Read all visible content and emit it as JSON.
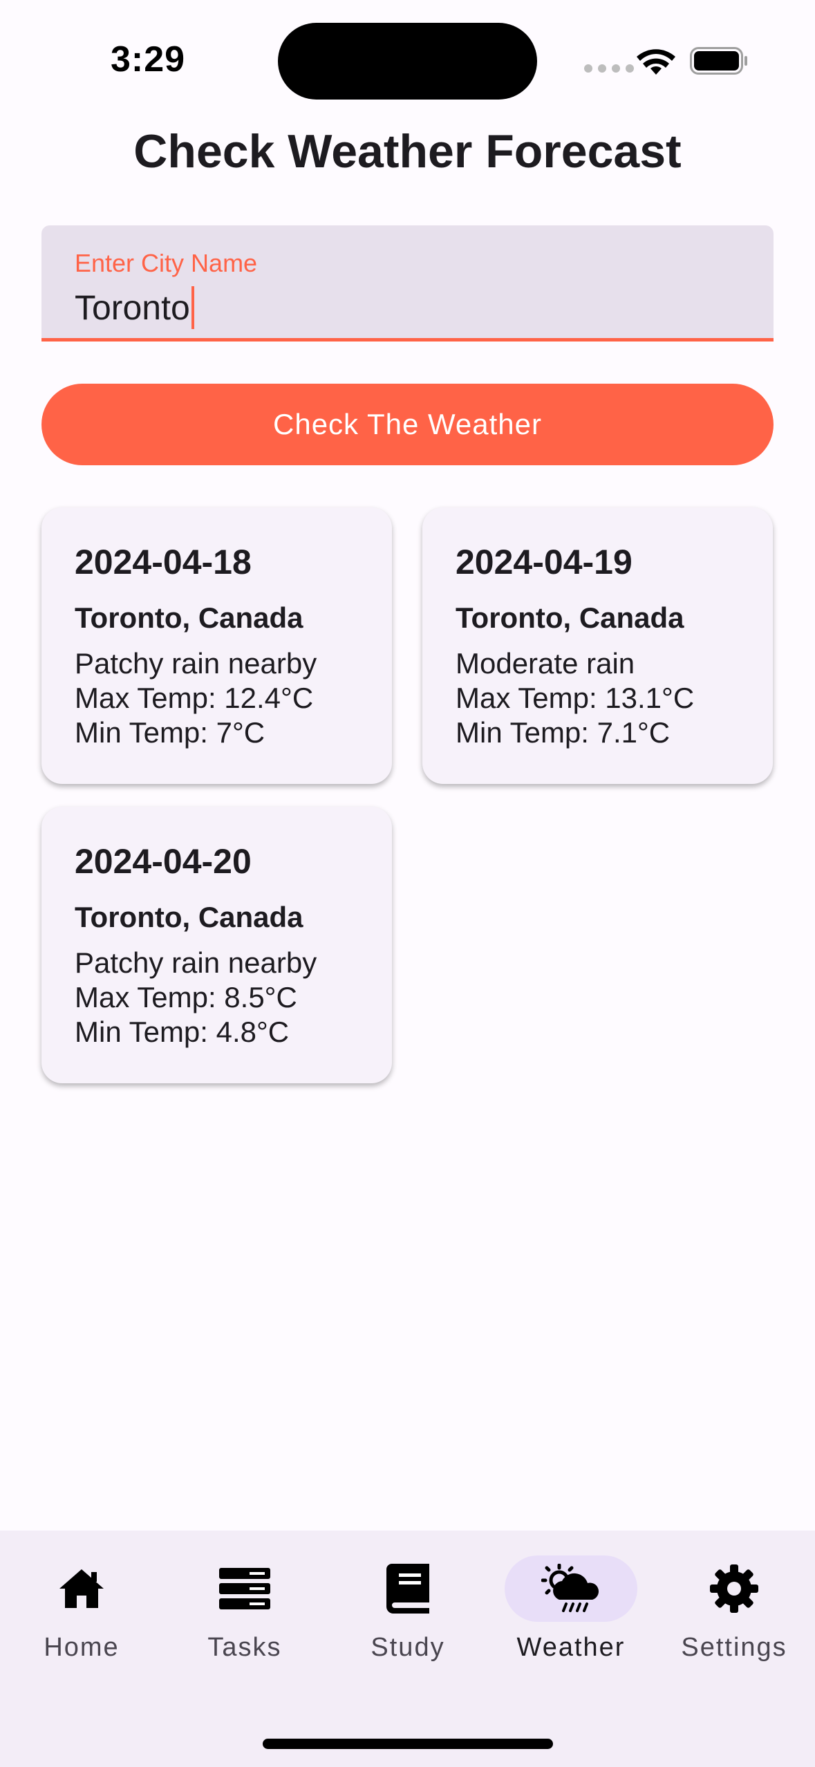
{
  "status_bar": {
    "time": "3:29"
  },
  "header": {
    "title": "Check Weather Forecast"
  },
  "search": {
    "label": "Enter City Name",
    "value": "Toronto"
  },
  "action": {
    "button_label": "Check The Weather"
  },
  "forecasts": [
    {
      "date": "2024-04-18",
      "location": "Toronto, Canada",
      "condition": "Patchy rain nearby",
      "max": "Max Temp: 12.4°C",
      "min": "Min Temp: 7°C"
    },
    {
      "date": "2024-04-19",
      "location": "Toronto, Canada",
      "condition": "Moderate rain",
      "max": "Max Temp: 13.1°C",
      "min": "Min Temp: 7.1°C"
    },
    {
      "date": "2024-04-20",
      "location": "Toronto, Canada",
      "condition": "Patchy rain nearby",
      "max": "Max Temp: 8.5°C",
      "min": "Min Temp: 4.8°C"
    }
  ],
  "nav": {
    "active": "Weather",
    "items": [
      {
        "label": "Home",
        "icon": "home-icon"
      },
      {
        "label": "Tasks",
        "icon": "tasks-icon"
      },
      {
        "label": "Study",
        "icon": "book-icon"
      },
      {
        "label": "Weather",
        "icon": "weather-icon"
      },
      {
        "label": "Settings",
        "icon": "gear-icon"
      }
    ]
  },
  "colors": {
    "accent": "#FF6347",
    "field_bg": "#E7E0EC",
    "card_bg": "#F7F2FA",
    "nav_bg": "#F3EDF7",
    "nav_active": "#E8DEF8"
  }
}
